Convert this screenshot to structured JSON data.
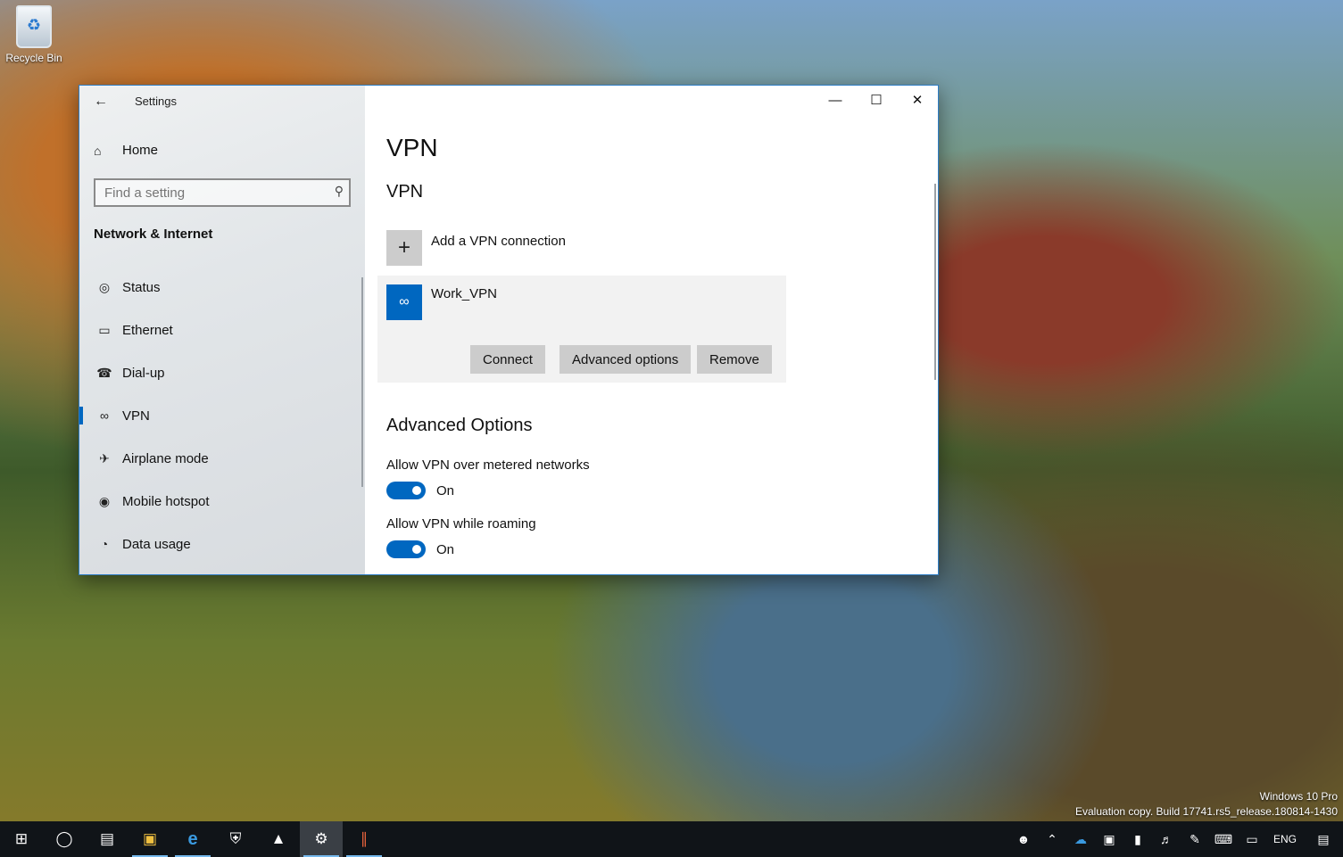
{
  "desktop": {
    "recycle_bin_label": "Recycle Bin",
    "watermark_line1": "Windows 10 Pro",
    "watermark_line2": "Evaluation copy. Build 17741.rs5_release.180814-1430"
  },
  "window": {
    "title": "Settings",
    "controls": {
      "minimize": "—",
      "maximize": "☐",
      "close": "✕"
    }
  },
  "sidebar": {
    "home_label": "Home",
    "search": {
      "placeholder": "Find a setting",
      "value": ""
    },
    "section_title": "Network & Internet",
    "items": [
      {
        "label": "Status",
        "icon": "globe-icon",
        "glyph": "◎"
      },
      {
        "label": "Ethernet",
        "icon": "ethernet-icon",
        "glyph": "▭"
      },
      {
        "label": "Dial-up",
        "icon": "dialup-icon",
        "glyph": "☎"
      },
      {
        "label": "VPN",
        "icon": "vpn-icon",
        "glyph": "∞",
        "active": true
      },
      {
        "label": "Airplane mode",
        "icon": "airplane-icon",
        "glyph": "✈"
      },
      {
        "label": "Mobile hotspot",
        "icon": "hotspot-icon",
        "glyph": "◉"
      },
      {
        "label": "Data usage",
        "icon": "data-usage-icon",
        "glyph": "◔"
      }
    ]
  },
  "main": {
    "page_title": "VPN",
    "vpn_section_title": "VPN",
    "add_vpn_label": "Add a VPN connection",
    "connection": {
      "name": "Work_VPN",
      "connect_label": "Connect",
      "advanced_label": "Advanced options",
      "remove_label": "Remove"
    },
    "advanced": {
      "title": "Advanced Options",
      "metered": {
        "label": "Allow VPN over metered networks",
        "state": "On",
        "on": true
      },
      "roaming": {
        "label": "Allow VPN while roaming",
        "state": "On",
        "on": true
      }
    }
  },
  "taskbar": {
    "apps": [
      {
        "name": "start-button",
        "glyph": "⊞"
      },
      {
        "name": "cortana-button",
        "glyph": "◯"
      },
      {
        "name": "task-view-button",
        "glyph": "▤"
      },
      {
        "name": "file-explorer-button",
        "glyph": "▣",
        "running": true
      },
      {
        "name": "edge-button",
        "glyph": "e",
        "running": true
      },
      {
        "name": "security-button",
        "glyph": "⛨"
      },
      {
        "name": "photos-button",
        "glyph": "▲"
      },
      {
        "name": "settings-button",
        "glyph": "⚙",
        "running": true,
        "active": true
      },
      {
        "name": "app-button",
        "glyph": "∥",
        "running": true
      }
    ],
    "language": "ENG"
  },
  "colors": {
    "accent": "#0067c0",
    "window_border": "#2d7cc4",
    "taskbar": "#101418"
  }
}
